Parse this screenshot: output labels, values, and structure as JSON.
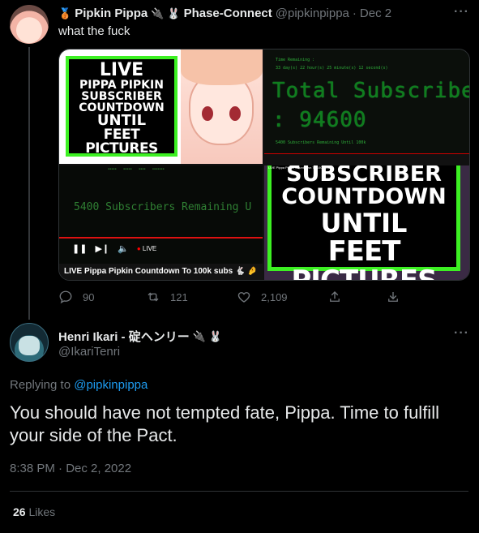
{
  "parent_tweet": {
    "display_name": "Pipkin Pippa",
    "name_suffix_icons": [
      "medal-emoji",
      "plug-emoji",
      "rabbit-emoji"
    ],
    "affiliation": "Phase-Connect",
    "handle": "@pipkinpippa",
    "date": "Dec 2",
    "separator": "·",
    "more_label": "···",
    "text": "what the fuck",
    "media": {
      "img1": {
        "lines": [
          "LIVE",
          "PIPPA PIPKIN",
          "SUBSCRIBER",
          "COUNTDOWN",
          "UNTIL",
          "FEET PICTURES"
        ]
      },
      "img2": {
        "remaining_label": "Time Remaining :",
        "remaining_value": "33 day(s) 22 hour(s) 25 minute(s) 12 second(s)",
        "big_title": "Total Subscribers",
        "big_value": ": 94600",
        "sub_line": "5400 Subscribers Remaining Until 100k"
      },
      "img3": {
        "big_text": "5400 Subscribers Remaining U",
        "live_label": "LIVE",
        "caption": "LIVE Pippa Pipkin Countdown To 100k subs 🐇 🤌"
      },
      "img4": {
        "top_caption": "LIVE Pippa Pipkin Countdown To 100k subs",
        "lines": [
          "SUBSCRIBER",
          "COUNTDOWN",
          "UNTIL",
          "FEET PICTURES"
        ]
      }
    },
    "actions": {
      "replies": "90",
      "retweets": "121",
      "likes": "2,109"
    }
  },
  "main_tweet": {
    "display_name": "Henri Ikari - 碇ヘンリー",
    "name_suffix_icons": [
      "plug-emoji",
      "rabbit-emoji"
    ],
    "handle": "@IkariTenri",
    "more_label": "···",
    "replying_to_prefix": "Replying to",
    "replying_to_handle": "@pipkinpippa",
    "text": "You should have not tempted fate, Pippa. Time to fulfill your side of the Pact.",
    "timestamp": "8:38 PM · Dec 2, 2022",
    "like_count": "26",
    "like_label": "Likes"
  },
  "colors": {
    "background": "#000000",
    "text_primary": "#e7e9ea",
    "text_muted": "#71767b",
    "link": "#1d9bf0",
    "divider": "#2f3336",
    "green_frame": "#3cf022"
  }
}
